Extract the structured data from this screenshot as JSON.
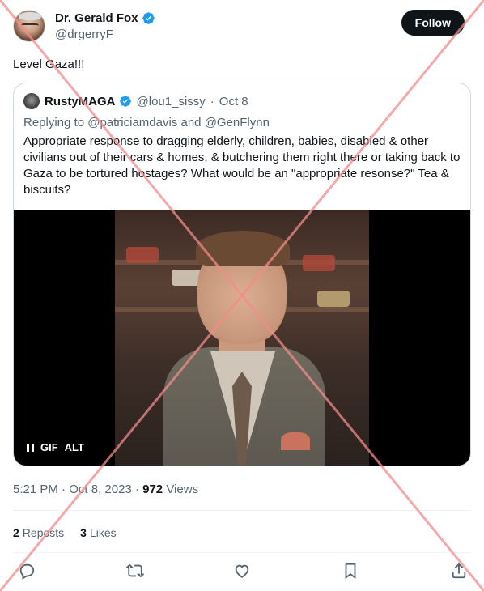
{
  "author": {
    "name": "Dr. Gerald Fox",
    "handle": "@drgerryF",
    "follow_label": "Follow"
  },
  "tweet": {
    "text": "Level Gaza!!!"
  },
  "quote": {
    "name": "RustyMAGA",
    "handle": "@lou1_sissy",
    "separator": "·",
    "date": "Oct 8",
    "reply_prefix": "Replying to",
    "reply_to_1": "@patriciamdavis",
    "reply_and": "and",
    "reply_to_2": "@GenFlynn",
    "text": "Appropriate response to dragging elderly, children, babies, disabled & other civilians out of their cars & homes, & butchering them right there or taking back to Gaza to be tortured hostages? What would be an \"appropriate resonse?\" Tea & biscuits?",
    "media": {
      "gif_label": "GIF",
      "alt_label": "ALT"
    }
  },
  "meta": {
    "time": "5:21 PM",
    "dot": "·",
    "date": "Oct 8, 2023",
    "dot2": "·",
    "views_count": "972",
    "views_label": "Views"
  },
  "stats": {
    "reposts_count": "2",
    "reposts_label": "Reposts",
    "likes_count": "3",
    "likes_label": "Likes"
  },
  "colors": {
    "verified": "#1d9bf0",
    "muted": "#536471",
    "overlay_x": "#f28b8b"
  },
  "icons": [
    "reply-icon",
    "repost-icon",
    "like-icon",
    "bookmark-icon",
    "share-icon"
  ]
}
